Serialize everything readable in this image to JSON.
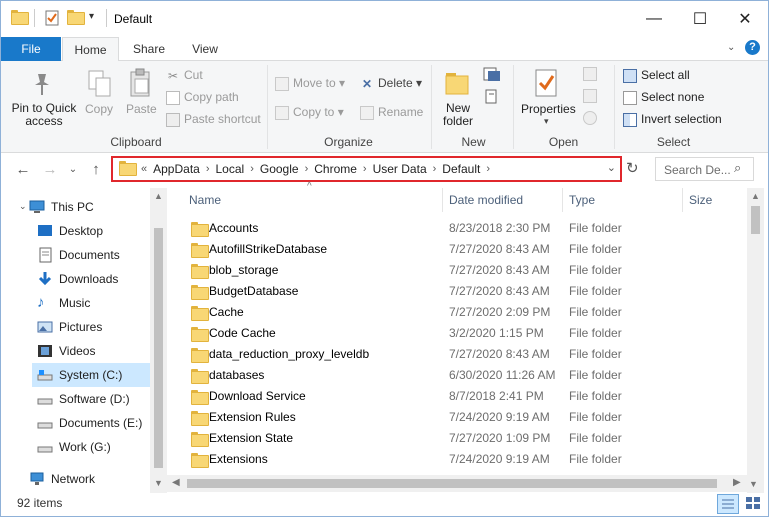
{
  "window": {
    "title": "Default",
    "minimize": "—",
    "maximize": "☐",
    "close": "✕"
  },
  "tabs": [
    {
      "label": "File"
    },
    {
      "label": "Home"
    },
    {
      "label": "Share"
    },
    {
      "label": "View"
    }
  ],
  "ribbon": {
    "clipboard": {
      "label": "Clipboard",
      "pin": "Pin to Quick access",
      "copy": "Copy",
      "paste": "Paste",
      "cut": "Cut",
      "copy_path": "Copy path",
      "paste_shortcut": "Paste shortcut"
    },
    "organize": {
      "label": "Organize",
      "move_to": "Move to",
      "copy_to": "Copy to",
      "delete": "Delete",
      "rename": "Rename"
    },
    "new": {
      "label": "New",
      "new_folder": "New folder"
    },
    "open": {
      "label": "Open",
      "properties": "Properties"
    },
    "select": {
      "label": "Select",
      "select_all": "Select all",
      "select_none": "Select none",
      "invert_selection": "Invert selection"
    }
  },
  "address": {
    "crumbs": [
      "AppData",
      "Local",
      "Google",
      "Chrome",
      "User Data",
      "Default"
    ],
    "overflow": "«",
    "search_placeholder": "Search De..."
  },
  "navpane": {
    "items": [
      {
        "label": "This PC",
        "icon": "computer-icon"
      },
      {
        "label": "Desktop",
        "icon": "desktop-icon"
      },
      {
        "label": "Documents",
        "icon": "documents-icon"
      },
      {
        "label": "Downloads",
        "icon": "downloads-icon"
      },
      {
        "label": "Music",
        "icon": "music-icon"
      },
      {
        "label": "Pictures",
        "icon": "pictures-icon"
      },
      {
        "label": "Videos",
        "icon": "videos-icon"
      },
      {
        "label": "System (C:)",
        "icon": "drive-icon",
        "selected": true
      },
      {
        "label": "Software (D:)",
        "icon": "drive-icon"
      },
      {
        "label": "Documents (E:)",
        "icon": "drive-icon"
      },
      {
        "label": "Work (G:)",
        "icon": "drive-icon"
      },
      {
        "label": "Network",
        "icon": "network-icon"
      }
    ]
  },
  "columns": {
    "name": "Name",
    "date": "Date modified",
    "type": "Type",
    "size": "Size"
  },
  "files": [
    {
      "name": "Accounts",
      "date": "8/23/2018 2:30 PM",
      "type": "File folder"
    },
    {
      "name": "AutofillStrikeDatabase",
      "date": "7/27/2020 8:43 AM",
      "type": "File folder"
    },
    {
      "name": "blob_storage",
      "date": "7/27/2020 8:43 AM",
      "type": "File folder"
    },
    {
      "name": "BudgetDatabase",
      "date": "7/27/2020 8:43 AM",
      "type": "File folder"
    },
    {
      "name": "Cache",
      "date": "7/27/2020 2:09 PM",
      "type": "File folder"
    },
    {
      "name": "Code Cache",
      "date": "3/2/2020 1:15 PM",
      "type": "File folder"
    },
    {
      "name": "data_reduction_proxy_leveldb",
      "date": "7/27/2020 8:43 AM",
      "type": "File folder"
    },
    {
      "name": "databases",
      "date": "6/30/2020 11:26 AM",
      "type": "File folder"
    },
    {
      "name": "Download Service",
      "date": "8/7/2018 2:41 PM",
      "type": "File folder"
    },
    {
      "name": "Extension Rules",
      "date": "7/24/2020 9:19 AM",
      "type": "File folder"
    },
    {
      "name": "Extension State",
      "date": "7/27/2020 1:09 PM",
      "type": "File folder"
    },
    {
      "name": "Extensions",
      "date": "7/24/2020 9:19 AM",
      "type": "File folder"
    }
  ],
  "status": {
    "items": "92 items"
  },
  "colors": {
    "accent": "#1979ca",
    "highlight": "#e0272c",
    "selected": "#cce8ff",
    "folder": "#f8d775"
  }
}
